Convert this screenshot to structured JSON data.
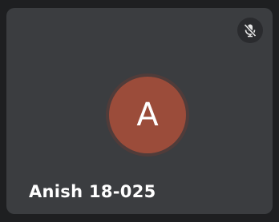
{
  "participant": {
    "initial": "A",
    "name": "Anish 18-025",
    "avatar_color": "#9b4c3a",
    "muted": true,
    "mute_icon": "microphone-off-icon"
  }
}
